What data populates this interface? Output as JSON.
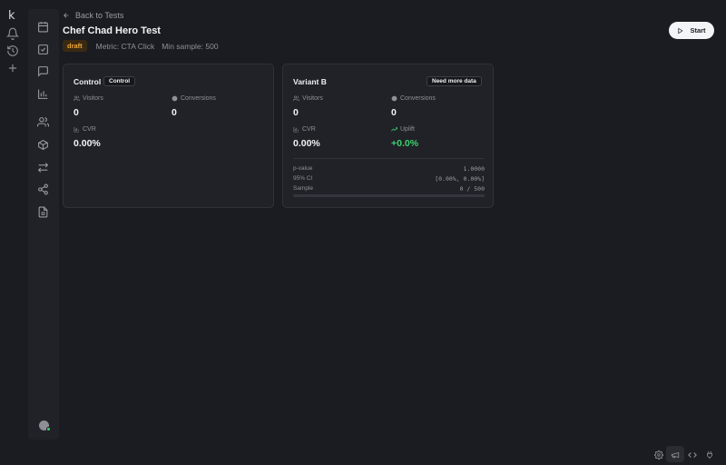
{
  "app": {
    "logo": "k"
  },
  "header": {
    "back_label": "Back to Tests",
    "title": "Chef Chad Hero Test",
    "status": "draft",
    "metric": "Metric: CTA Click",
    "min_sample": "Min sample: 500",
    "start_label": "Start"
  },
  "control": {
    "title": "Control",
    "tag": "Control",
    "visitors_label": "Visitors",
    "visitors": "0",
    "conversions_label": "Conversions",
    "conversions": "0",
    "cvr_label": "CVR",
    "cvr": "0.00%"
  },
  "variant": {
    "title": "Variant B",
    "tag": "Need more data",
    "visitors_label": "Visitors",
    "visitors": "0",
    "conversions_label": "Conversions",
    "conversions": "0",
    "cvr_label": "CVR",
    "cvr": "0.00%",
    "uplift_label": "Uplift",
    "uplift": "+0.0%",
    "pvalue_label": "p-value",
    "pvalue": "1.0000",
    "ci_label": "95% CI",
    "ci": "[0.00%, 0.00%]",
    "sample_label": "Sample",
    "sample": "0 / 500",
    "sample_progress": 0
  },
  "colors": {
    "accent_green": "#3ecf6e",
    "draft_badge": "#f2a83b",
    "background": "#1b1c21"
  },
  "icons": {
    "rail": [
      "bell-icon",
      "history-icon",
      "plus-icon"
    ],
    "sidebar": [
      "calendar-icon",
      "checkbox-icon",
      "message-icon",
      "bar-chart-icon",
      "users-icon",
      "box-icon",
      "transfer-icon",
      "share-icon",
      "document-icon"
    ],
    "tools": [
      "settings-icon",
      "megaphone-icon",
      "code-icon",
      "plugin-icon"
    ]
  }
}
